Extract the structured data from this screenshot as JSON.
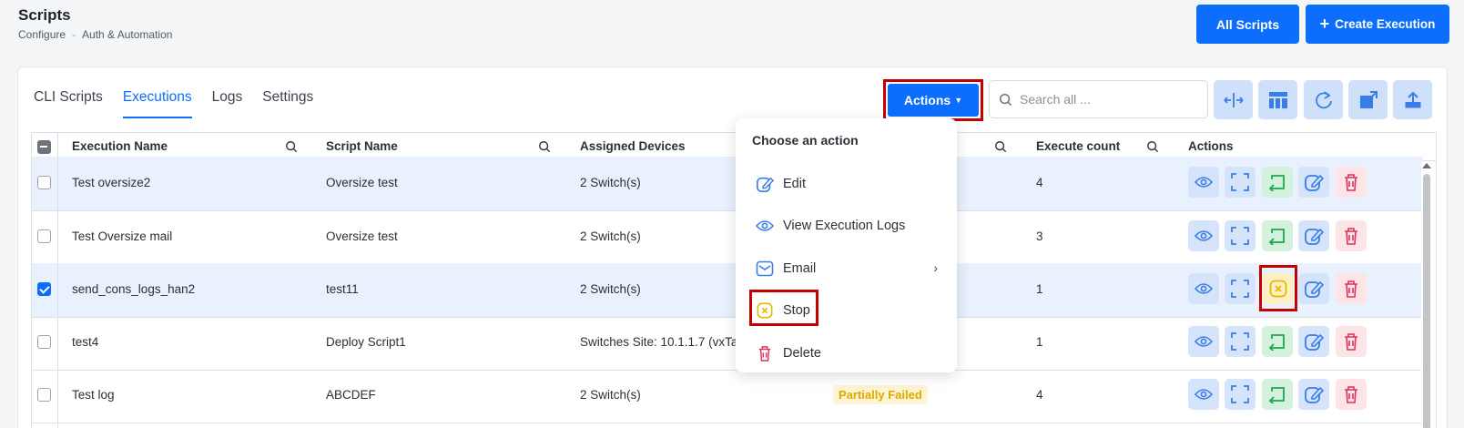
{
  "header": {
    "title": "Scripts",
    "breadcrumb": [
      "Configure",
      "Auth & Automation"
    ],
    "breadcrumb_sep": "-",
    "all_scripts_label": "All Scripts",
    "create_execution_label": "Create Execution"
  },
  "tabs": [
    {
      "label": "CLI Scripts"
    },
    {
      "label": "Executions"
    },
    {
      "label": "Logs"
    },
    {
      "label": "Settings"
    }
  ],
  "toolbar": {
    "actions_label": "Actions",
    "search_placeholder": "Search all ..."
  },
  "table": {
    "columns": [
      "Execution Name",
      "Script Name",
      "Assigned Devices",
      "Execute count",
      "Actions"
    ],
    "rows": [
      {
        "name": "Test oversize2",
        "script": "Oversize test",
        "devices": "2 Switch(s)",
        "count": "4",
        "checked": false
      },
      {
        "name": "Test Oversize mail",
        "script": "Oversize test",
        "devices": "2 Switch(s)",
        "count": "3",
        "checked": false
      },
      {
        "name": "send_cons_logs_han2",
        "script": "test11",
        "devices": "2 Switch(s)",
        "count": "1",
        "checked": true
      },
      {
        "name": "test4",
        "script": "Deploy Script1",
        "devices": "Switches Site: 10.1.1.7 (vxTarg",
        "count": "1",
        "checked": false
      },
      {
        "name": "Test log",
        "script": "ABCDEF",
        "devices": "2 Switch(s)",
        "count": "4",
        "checked": false,
        "status": "Partially Failed"
      }
    ]
  },
  "dropdown": {
    "title": "Choose an action",
    "items": [
      {
        "label": "Edit",
        "icon": "edit-icon"
      },
      {
        "label": "View Execution Logs",
        "icon": "eye-icon"
      },
      {
        "label": "Email",
        "icon": "mail-icon"
      },
      {
        "label": "Stop",
        "icon": "stop-icon"
      },
      {
        "label": "Delete",
        "icon": "trash-icon"
      }
    ]
  },
  "colors": {
    "primary": "#0d6efd",
    "highlight_outline": "#c40000",
    "stop_yellow": "#e6b800",
    "delete_red": "#e0315a",
    "rerun_green": "#1fa74a"
  }
}
